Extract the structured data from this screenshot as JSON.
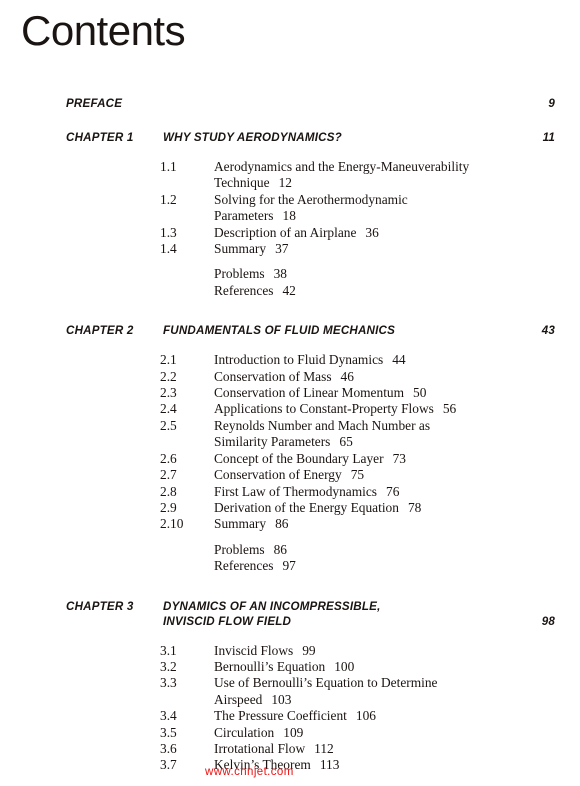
{
  "page": {
    "title": "Contents",
    "watermark": "www.chnjet.com"
  },
  "entries": [
    {
      "label": "PREFACE",
      "title": "",
      "page": "9"
    },
    {
      "label": "CHAPTER 1",
      "title": "WHY STUDY AERODYNAMICS?",
      "page": "11"
    },
    {
      "label": "CHAPTER 2",
      "title": "FUNDAMENTALS OF FLUID MECHANICS",
      "page": "43"
    },
    {
      "label": "CHAPTER 3",
      "title": "DYNAMICS OF AN INCOMPRESSIBLE,\nINVISCID FLOW FIELD",
      "page": "98"
    }
  ],
  "chapter1_sections": [
    {
      "num": "1.1",
      "title": "Aerodynamics and the Energy-Maneuverability\nTechnique",
      "page": "12"
    },
    {
      "num": "1.2",
      "title": "Solving for the Aerothermodynamic\nParameters",
      "page": "18"
    },
    {
      "num": "1.3",
      "title": "Description of an Airplane",
      "page": "36"
    },
    {
      "num": "1.4",
      "title": "Summary",
      "page": "37"
    }
  ],
  "chapter1_endmatter": [
    {
      "num": "",
      "title": "Problems",
      "page": "38"
    },
    {
      "num": "",
      "title": "References",
      "page": "42"
    }
  ],
  "chapter2_sections": [
    {
      "num": "2.1",
      "title": "Introduction to Fluid Dynamics",
      "page": "44"
    },
    {
      "num": "2.2",
      "title": "Conservation of Mass",
      "page": "46"
    },
    {
      "num": "2.3",
      "title": "Conservation of Linear Momentum",
      "page": "50"
    },
    {
      "num": "2.4",
      "title": "Applications to Constant-Property Flows",
      "page": "56"
    },
    {
      "num": "2.5",
      "title": "Reynolds Number and Mach Number as\nSimilarity Parameters",
      "page": "65"
    },
    {
      "num": "2.6",
      "title": "Concept of the Boundary Layer",
      "page": "73"
    },
    {
      "num": "2.7",
      "title": "Conservation of Energy",
      "page": "75"
    },
    {
      "num": "2.8",
      "title": "First Law of Thermodynamics",
      "page": "76"
    },
    {
      "num": "2.9",
      "title": "Derivation of the Energy Equation",
      "page": "78"
    },
    {
      "num": "2.10",
      "title": "Summary",
      "page": "86"
    }
  ],
  "chapter2_endmatter": [
    {
      "num": "",
      "title": "Problems",
      "page": "86"
    },
    {
      "num": "",
      "title": "References",
      "page": "97"
    }
  ],
  "chapter3_sections": [
    {
      "num": "3.1",
      "title": "Inviscid Flows",
      "page": "99"
    },
    {
      "num": "3.2",
      "title": "Bernoulli’s Equation",
      "page": "100"
    },
    {
      "num": "3.3",
      "title": "Use of Bernoulli’s Equation to Determine\nAirspeed",
      "page": "103"
    },
    {
      "num": "3.4",
      "title": "The Pressure Coefficient",
      "page": "106"
    },
    {
      "num": "3.5",
      "title": "Circulation",
      "page": "109"
    },
    {
      "num": "3.6",
      "title": "Irrotational Flow",
      "page": "112"
    },
    {
      "num": "3.7",
      "title": "Kelvin’s Theorem",
      "page": "113"
    }
  ]
}
